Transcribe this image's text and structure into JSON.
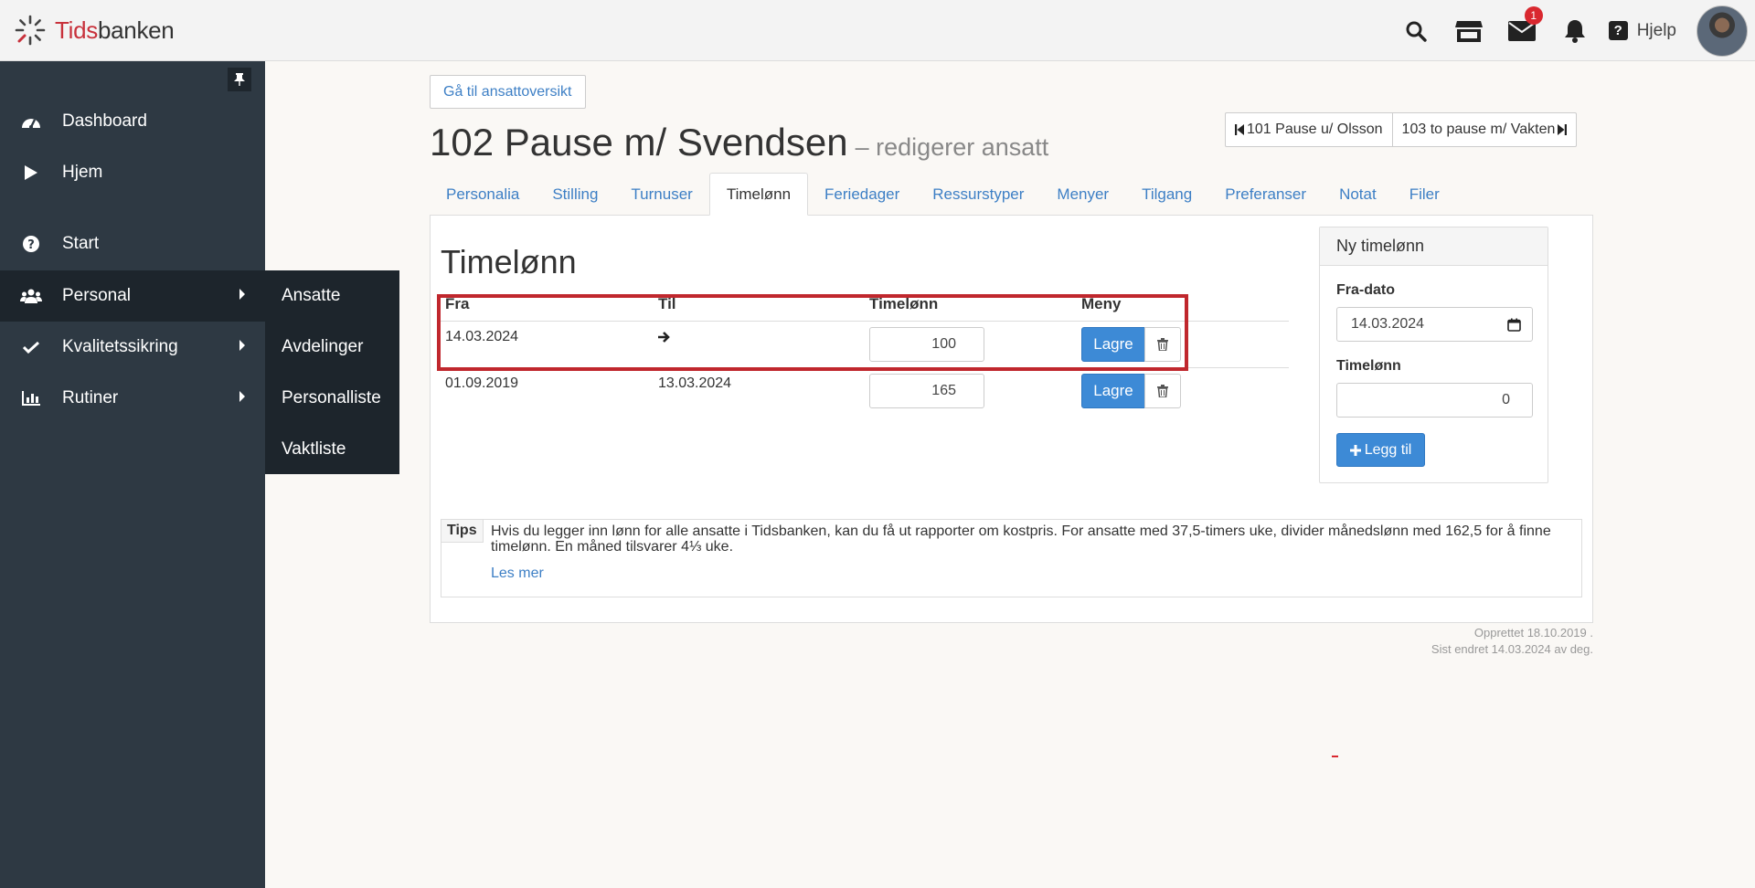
{
  "brand": {
    "name_red": "Tids",
    "name_rest": "banken"
  },
  "topbar": {
    "mail_badge": "1",
    "help_label": "Hjelp"
  },
  "sidebar": {
    "items": [
      {
        "label": "Dashboard",
        "icon": "dashboard-icon"
      },
      {
        "label": "Hjem",
        "icon": "play-icon"
      },
      {
        "label": "Start",
        "icon": "question-circle-icon"
      },
      {
        "label": "Personal",
        "icon": "users-icon"
      },
      {
        "label": "Kvalitetssikring",
        "icon": "check-icon"
      },
      {
        "label": "Rutiner",
        "icon": "bar-chart-icon"
      }
    ],
    "submenu": [
      "Ansatte",
      "Avdelinger",
      "Personalliste",
      "Vaktliste"
    ]
  },
  "main": {
    "goto_label": "Gå til ansattoversikt",
    "title": "102 Pause m/ Svendsen",
    "subtitle": "– redigerer ansatt",
    "prev_label": "101 Pause u/ Olsson",
    "next_label": "103 to pause m/ Vakten",
    "tabs": [
      "Personalia",
      "Stilling",
      "Turnuser",
      "Timelønn",
      "Feriedager",
      "Ressurstyper",
      "Menyer",
      "Tilgang",
      "Preferanser",
      "Notat",
      "Filer"
    ],
    "active_tab": "Timelønn"
  },
  "wages": {
    "title": "Timelønn",
    "headers": {
      "from": "Fra",
      "to": "Til",
      "wage": "Timelønn",
      "menu": "Meny"
    },
    "rows": [
      {
        "from": "14.03.2024",
        "to": "",
        "wage": "100",
        "save": "Lagre"
      },
      {
        "from": "01.09.2019",
        "to": "13.03.2024",
        "wage": "165",
        "save": "Lagre"
      }
    ]
  },
  "new_wage": {
    "title": "Ny timelønn",
    "from_label": "Fra-dato",
    "from_value": "14.03.2024",
    "wage_label": "Timelønn",
    "wage_value": "0",
    "add_label": "Legg til"
  },
  "tips": {
    "label": "Tips",
    "text": "Hvis du legger inn lønn for alle ansatte i Tidsbanken, kan du få ut rapporter om kostpris. For ansatte med 37,5-timers uke, divider månedslønn med 162,5 for å finne timelønn. En måned tilsvarer 4⅓ uke.",
    "link": "Les mer"
  },
  "meta": {
    "created": "Opprettet 18.10.2019 .",
    "modified": "Sist endret 14.03.2024 av deg."
  },
  "colors": {
    "accent": "#3d8ad6",
    "link": "#3d7fc5",
    "sidebar": "#2e3943",
    "highlight": "#c0272d"
  }
}
